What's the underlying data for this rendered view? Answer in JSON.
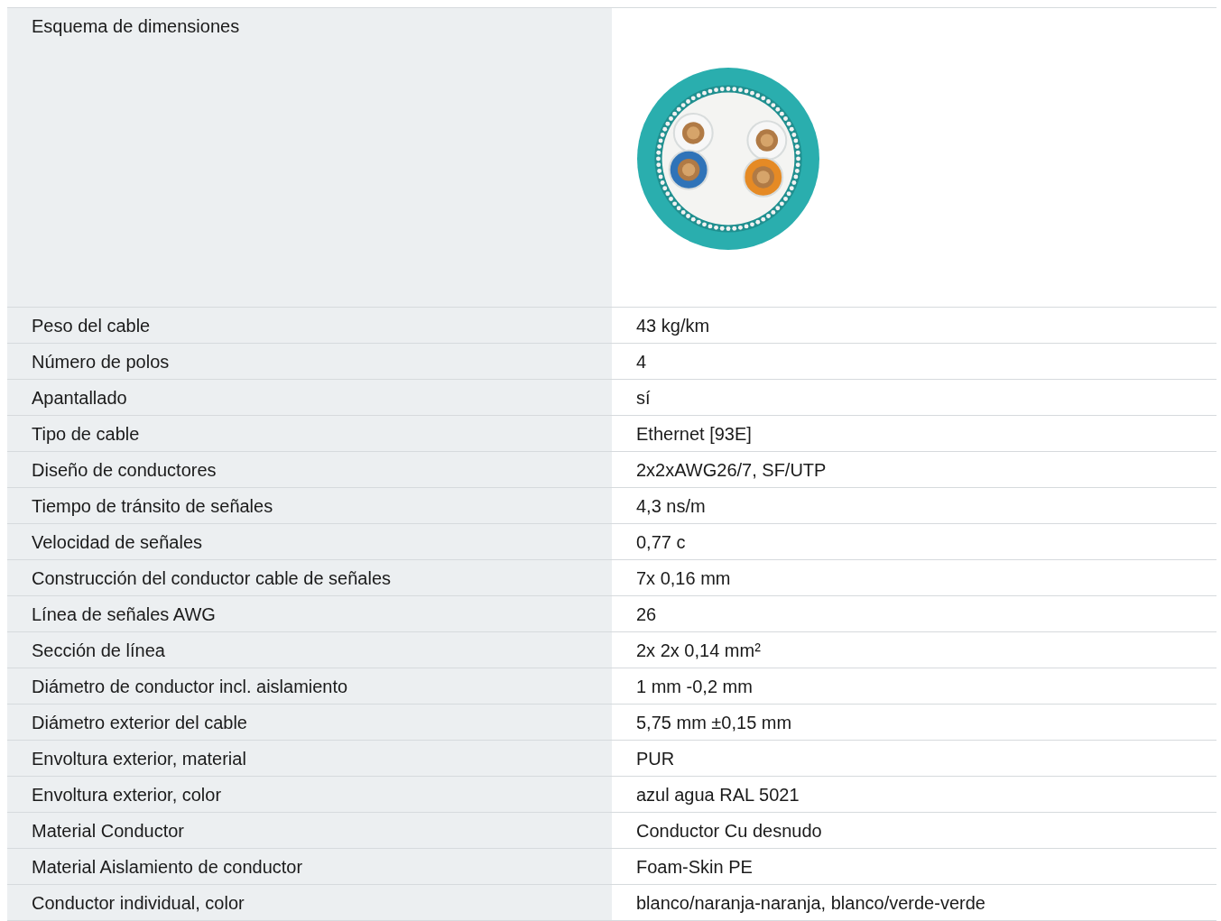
{
  "table": {
    "rows": [
      {
        "kind": "image",
        "label": "Esquema de dimensiones"
      },
      {
        "kind": "text",
        "label": "Peso del cable",
        "value": "43 kg/km"
      },
      {
        "kind": "text",
        "label": "Número de polos",
        "value": "4"
      },
      {
        "kind": "text",
        "label": "Apantallado",
        "value": "sí"
      },
      {
        "kind": "text",
        "label": "Tipo de cable",
        "value": "Ethernet [93E]"
      },
      {
        "kind": "text",
        "label": "Diseño de conductores",
        "value": "2x2xAWG26/7, SF/UTP"
      },
      {
        "kind": "text",
        "label": "Tiempo de tránsito de señales",
        "value": "4,3 ns/m"
      },
      {
        "kind": "text",
        "label": "Velocidad de señales",
        "value": "0,77 c"
      },
      {
        "kind": "text",
        "label": "Construcción del conductor cable de señales",
        "value": "7x 0,16 mm"
      },
      {
        "kind": "text",
        "label": "Línea de señales AWG",
        "value": "26"
      },
      {
        "kind": "text",
        "label": "Sección de línea",
        "value": "2x 2x 0,14 mm²"
      },
      {
        "kind": "text",
        "label": "Diámetro de conductor incl. aislamiento",
        "value": "1 mm -0,2 mm"
      },
      {
        "kind": "text",
        "label": "Diámetro exterior del cable",
        "value": "5,75 mm ±0,15 mm"
      },
      {
        "kind": "text",
        "label": "Envoltura exterior, material",
        "value": "PUR"
      },
      {
        "kind": "text",
        "label": "Envoltura exterior, color",
        "value": "azul agua RAL 5021"
      },
      {
        "kind": "text",
        "label": "Material Conductor",
        "value": "Conductor Cu desnudo"
      },
      {
        "kind": "text",
        "label": "Material Aislamiento de conductor",
        "value": "Foam-Skin PE"
      },
      {
        "kind": "text",
        "label": "Conductor individual, color",
        "value": "blanco/naranja-naranja, blanco/verde-verde"
      }
    ]
  }
}
